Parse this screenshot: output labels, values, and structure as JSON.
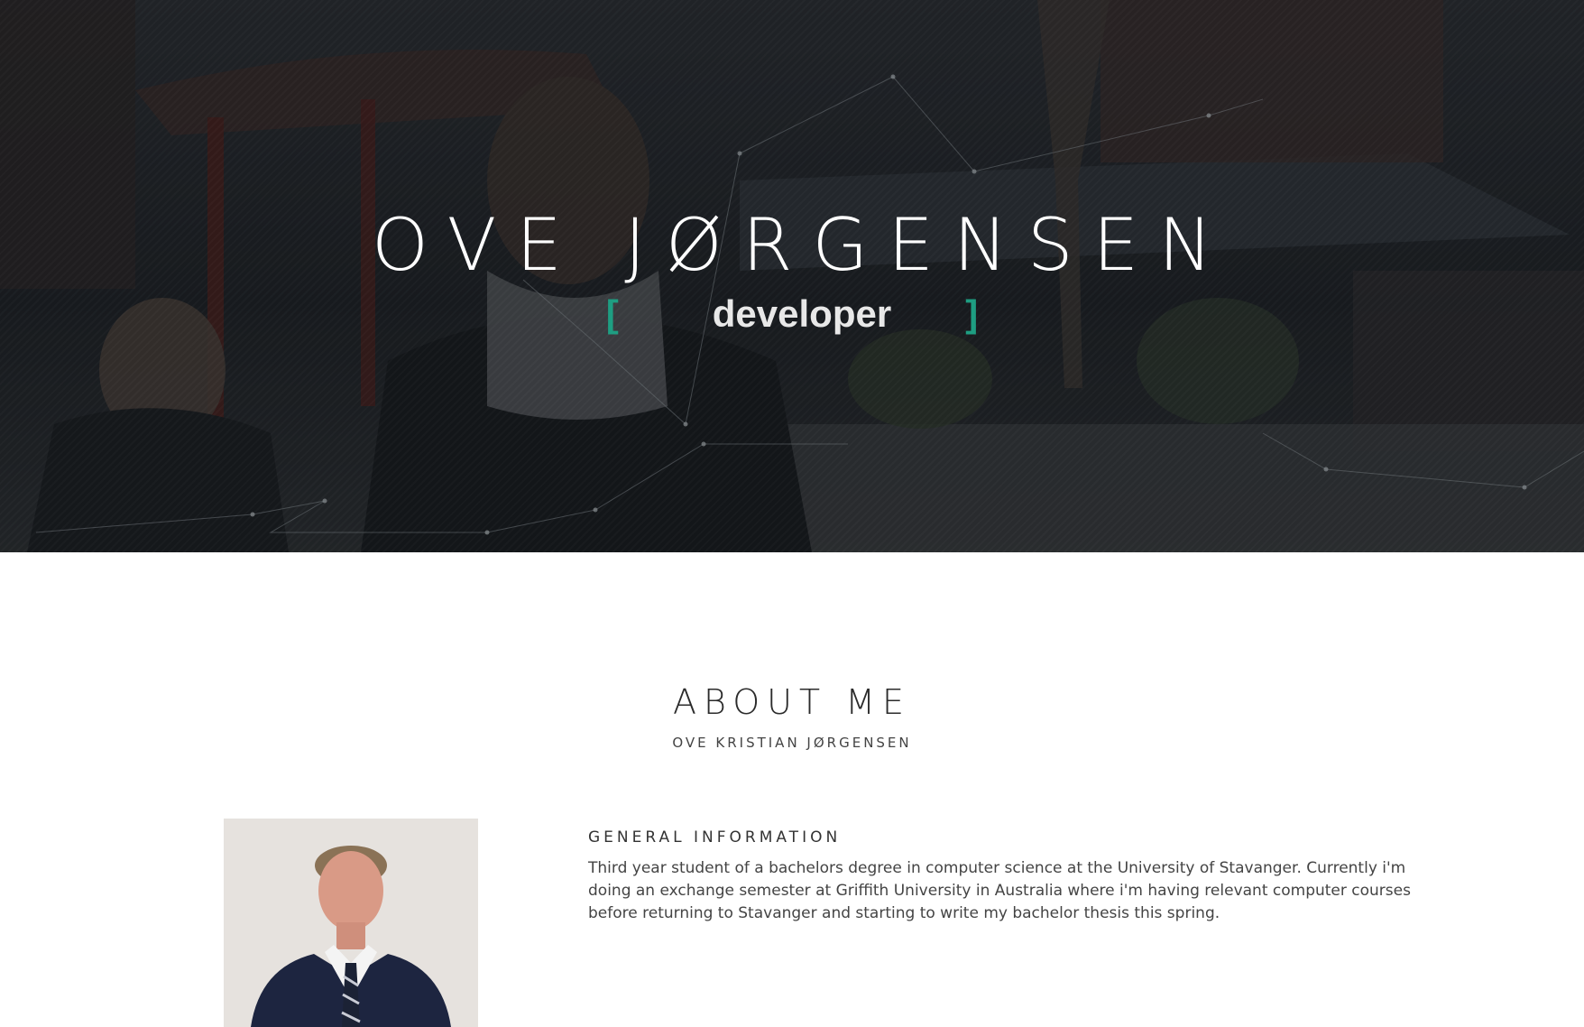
{
  "hero": {
    "name": "OVE JØRGENSEN",
    "bracket_open": "[",
    "role": "developer",
    "bracket_close": "]"
  },
  "about": {
    "heading": "ABOUT ME",
    "subheading": "OVE KRISTIAN JØRGENSEN",
    "general_title": "GENERAL INFORMATION",
    "general_text": "Third year student of a bachelors degree in computer science at the University of Stavanger. Currently i'm doing an exchange semester at Griffith University in Australia where i'm having relevant computer courses before returning to Stavanger and starting to write my bachelor thesis this spring."
  },
  "colors": {
    "accent": "#1e9e82",
    "hero_text": "#ffffff",
    "body_text": "#444444"
  }
}
